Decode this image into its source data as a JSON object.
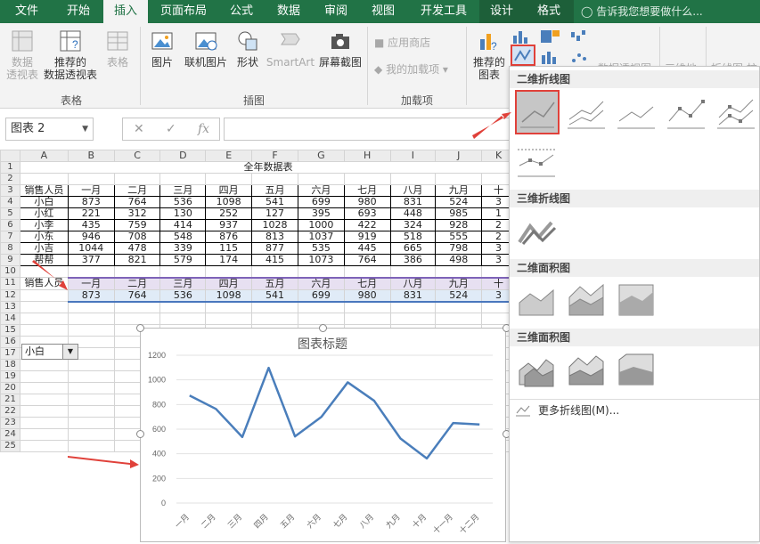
{
  "tabs": [
    "文件",
    "开始",
    "插入",
    "页面布局",
    "公式",
    "数据",
    "审阅",
    "视图",
    "开发工具",
    "设计",
    "格式"
  ],
  "active_tab": "插入",
  "tell_me": "告诉我您想要做什么...",
  "ribbon": {
    "pivot_chart_disabled": "数据\n透视表",
    "recommended_pivot": "推荐的\n数据透视表",
    "table": "表格",
    "group_tables": "表格",
    "picture": "图片",
    "online_picture": "联机图片",
    "shapes": "形状",
    "smartart": "SmartArt",
    "screenshot": "屏幕截图",
    "group_illustrations": "插图",
    "app_store": "应用商店",
    "my_addins": "我的加载项",
    "group_addins": "加载项",
    "recommended_charts": "推荐的\n图表",
    "pivot_chart": "数据透视图",
    "map_3d": "三维地",
    "sparkline_line": "折线图",
    "sparkline_col": "柱"
  },
  "namebox": "图表 2",
  "sheet": {
    "columns": [
      "A",
      "B",
      "C",
      "D",
      "E",
      "F",
      "G",
      "H",
      "I",
      "J",
      "K"
    ],
    "title": "全年数据表",
    "headers": [
      "销售人员",
      "一月",
      "二月",
      "三月",
      "四月",
      "五月",
      "六月",
      "七月",
      "八月",
      "九月",
      "十"
    ],
    "rows": [
      [
        "小白",
        "873",
        "764",
        "536",
        "1098",
        "541",
        "699",
        "980",
        "831",
        "524",
        "3"
      ],
      [
        "小红",
        "221",
        "312",
        "130",
        "252",
        "127",
        "395",
        "693",
        "448",
        "985",
        "1"
      ],
      [
        "小李",
        "435",
        "759",
        "414",
        "937",
        "1028",
        "1000",
        "422",
        "324",
        "928",
        "2"
      ],
      [
        "小东",
        "946",
        "708",
        "548",
        "876",
        "813",
        "1037",
        "919",
        "518",
        "555",
        "2"
      ],
      [
        "小吉",
        "1044",
        "478",
        "339",
        "115",
        "877",
        "535",
        "445",
        "665",
        "798",
        "3"
      ],
      [
        "帮帮",
        "377",
        "821",
        "579",
        "174",
        "415",
        "1073",
        "764",
        "386",
        "498",
        "3"
      ]
    ],
    "row_numbers": [
      "1",
      "2",
      "3",
      "4",
      "5",
      "6",
      "7",
      "8",
      "9",
      "10",
      "11",
      "12",
      "13",
      "14",
      "15",
      "16",
      "17",
      "18",
      "19",
      "20",
      "21",
      "22",
      "23",
      "24",
      "25"
    ],
    "lookup_header": [
      "销售人员",
      "一月",
      "二月",
      "三月",
      "四月",
      "五月",
      "六月",
      "七月",
      "八月",
      "九月",
      "十"
    ],
    "lookup_values": [
      "",
      "873",
      "764",
      "536",
      "1098",
      "541",
      "699",
      "980",
      "831",
      "524",
      "3"
    ],
    "combo_value": "小白"
  },
  "chart_data": {
    "type": "line",
    "title": "图表标题",
    "categories": [
      "一月",
      "二月",
      "三月",
      "四月",
      "五月",
      "六月",
      "七月",
      "八月",
      "九月",
      "十月",
      "十一月",
      "十二月"
    ],
    "series": [
      {
        "values": [
          873,
          764,
          536,
          1098,
          541,
          699,
          980,
          831,
          524,
          362,
          650,
          638
        ]
      }
    ],
    "ylim": [
      0,
      1200
    ],
    "yticks": [
      "0",
      "200",
      "400",
      "600",
      "800",
      "1000",
      "1200"
    ],
    "grid": true,
    "line_color": "#4a7ebb"
  },
  "gallery": {
    "sections": [
      "二维折线图",
      "三维折线图",
      "二维面积图",
      "三维面积图"
    ],
    "more": "更多折线图(M)..."
  },
  "colors": {
    "excel_green": "#217346",
    "annotation_red": "#e0413a"
  }
}
